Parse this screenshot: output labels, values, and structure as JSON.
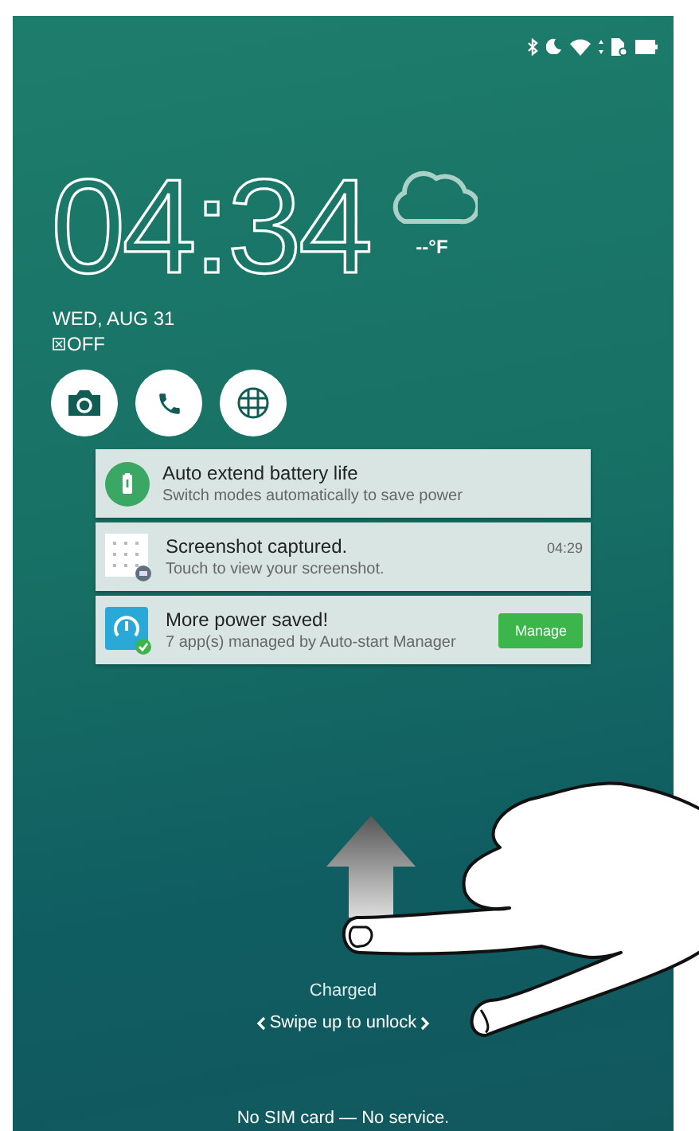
{
  "clock": {
    "time": "04:34"
  },
  "weather": {
    "temperature": "--°F"
  },
  "date": "WED, AUG 31",
  "alarm": "OFF",
  "notifications": [
    {
      "kind": "battery",
      "title": "Auto extend battery life",
      "text": "Switch modes automatically to save power"
    },
    {
      "kind": "screenshot",
      "title": "Screenshot captured.",
      "text": "Touch to view your screenshot.",
      "time": "04:29"
    },
    {
      "kind": "app",
      "title": "More power saved!",
      "text": "7 app(s) managed by Auto-start Manager",
      "action": "Manage"
    }
  ],
  "footer": {
    "status": "Charged",
    "hint": "Swipe up to unlock",
    "carrier": "No SIM card — No service."
  }
}
